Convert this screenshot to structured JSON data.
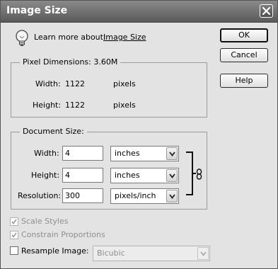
{
  "window": {
    "title": "Image Size"
  },
  "learn_more": {
    "prefix": "Learn more about:",
    "link": "Image Size"
  },
  "buttons": {
    "ok": "OK",
    "cancel": "Cancel",
    "help": "Help"
  },
  "pixel_dimensions": {
    "legend": "Pixel Dimensions:",
    "size": "3.60M",
    "width_label": "Width:",
    "width_value": "1122",
    "width_unit": "pixels",
    "height_label": "Height:",
    "height_value": "1122",
    "height_unit": "pixels"
  },
  "document_size": {
    "legend": "Document Size:",
    "width_label": "Width:",
    "width_value": "4",
    "width_unit": "inches",
    "height_label": "Height:",
    "height_value": "4",
    "height_unit": "inches",
    "resolution_label": "Resolution:",
    "resolution_value": "300",
    "resolution_unit": "pixels/inch"
  },
  "options": {
    "scale_styles": {
      "label": "Scale Styles",
      "checked": true,
      "enabled": false
    },
    "constrain_proportions": {
      "label": "Constrain Proportions",
      "checked": true,
      "enabled": false
    },
    "resample_image": {
      "label": "Resample Image:",
      "checked": false,
      "enabled": true
    },
    "resample_method": "Bicubic"
  },
  "colors": {
    "titlebar": "#6e6e6e",
    "dialog_bg": "#e3e3e3",
    "disabled_text": "#8f8f8f"
  },
  "icons": {
    "info": "lightbulb-icon",
    "close": "close-icon",
    "link": "chain-link-icon",
    "dropdown": "chevron-down-icon"
  }
}
